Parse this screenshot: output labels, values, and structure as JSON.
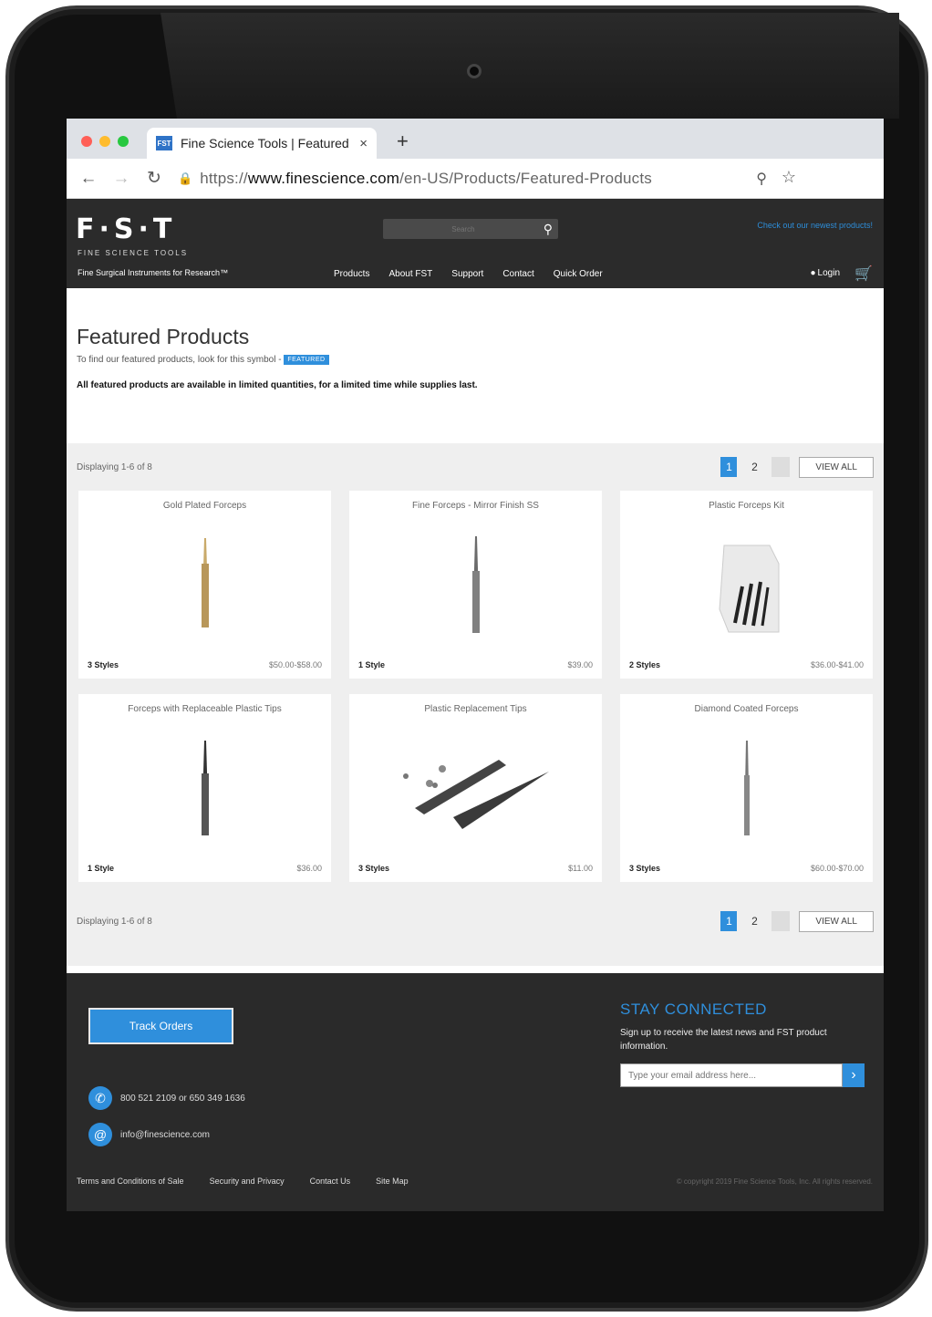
{
  "browser": {
    "tab_favicon": "FST",
    "tab_title": "Fine Science Tools | Featured",
    "tab_close": "×",
    "new_tab": "+",
    "url_scheme": "https://",
    "url_domain": "www.finescience.com",
    "url_path": "/en-US/Products/Featured-Products"
  },
  "header": {
    "logo": "F·S·T",
    "logo_sub": "FINE SCIENCE TOOLS",
    "tagline": "Fine Surgical Instruments for Research™",
    "search_placeholder": "Search",
    "promo": "Check out our newest products!",
    "nav": [
      "Products",
      "About FST",
      "Support",
      "Contact",
      "Quick Order"
    ],
    "login": "Login"
  },
  "intro": {
    "title": "Featured Products",
    "description": "To find our featured products, look for this symbol -",
    "badge": "FEATURED",
    "note": "All featured products are available in limited quantities, for a limited time while supplies last."
  },
  "paging": {
    "text": "Displaying 1-6 of 8",
    "pages": [
      "1",
      "2"
    ],
    "view_all": "VIEW ALL"
  },
  "products": [
    {
      "name": "Gold Plated Forceps",
      "styles": "3 Styles",
      "price": "$50.00-$58.00",
      "image": "gold-forceps"
    },
    {
      "name": "Fine Forceps - Mirror Finish SS",
      "styles": "1 Style",
      "price": "$39.00",
      "image": "steel-forceps"
    },
    {
      "name": "Plastic Forceps Kit",
      "styles": "2 Styles",
      "price": "$36.00-$41.00",
      "image": "forceps-kit"
    },
    {
      "name": "Forceps with Replaceable Plastic Tips",
      "styles": "1 Style",
      "price": "$36.00",
      "image": "dark-forceps"
    },
    {
      "name": "Plastic Replacement Tips",
      "styles": "3 Styles",
      "price": "$11.00",
      "image": "replacement-tips"
    },
    {
      "name": "Diamond Coated Forceps",
      "styles": "3 Styles",
      "price": "$60.00-$70.00",
      "image": "diamond-forceps"
    }
  ],
  "footer": {
    "track_orders": "Track Orders",
    "phone": "800 521 2109 or 650 349 1636",
    "email": "info@finescience.com",
    "stay_title": "STAY CONNECTED",
    "stay_desc": "Sign up to receive the latest news and FST product information.",
    "email_placeholder": "Type your email address here...",
    "links": [
      "Terms and Conditions of Sale",
      "Security and Privacy",
      "Contact Us",
      "Site Map"
    ],
    "copyright": "© copyright 2019 Fine Science Tools, Inc. All rights reserved."
  }
}
